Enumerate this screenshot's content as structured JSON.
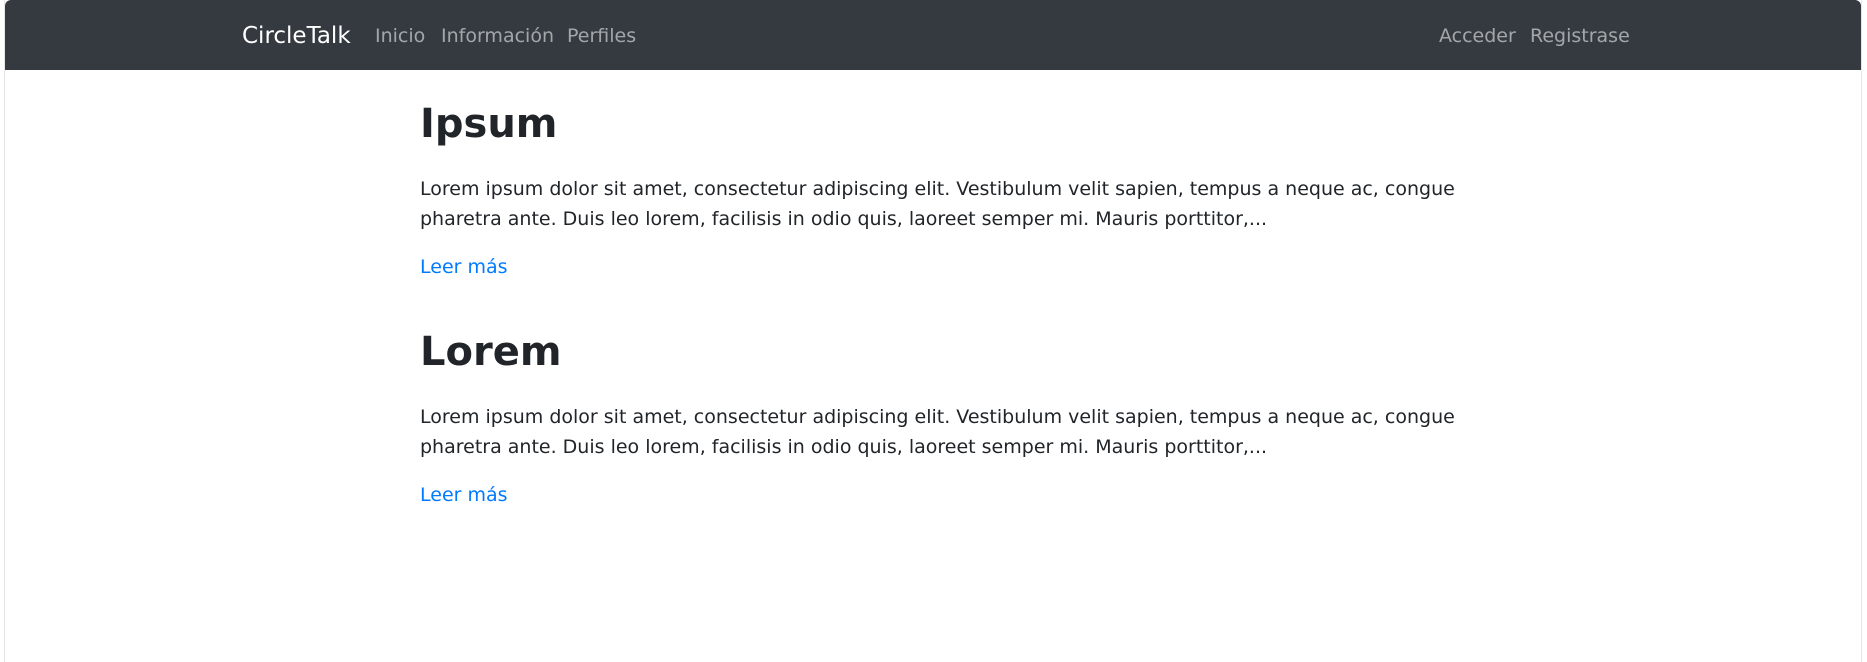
{
  "navbar": {
    "brand": "CircleTalk",
    "left_links": [
      {
        "label": "Inicio"
      },
      {
        "label": "Información"
      },
      {
        "label": "Perfiles"
      }
    ],
    "right_links": [
      {
        "label": "Acceder"
      },
      {
        "label": "Registrase"
      }
    ]
  },
  "posts": [
    {
      "title": "Ipsum",
      "excerpt": "Lorem ipsum dolor sit amet, consectetur adipiscing elit. Vestibulum velit sapien, tempus a neque ac, congue pharetra ante. Duis leo lorem, facilisis in odio quis, laoreet semper mi. Mauris porttitor,...",
      "link_label": "Leer más"
    },
    {
      "title": "Lorem",
      "excerpt": "Lorem ipsum dolor sit amet, consectetur adipiscing elit. Vestibulum velit sapien, tempus a neque ac, congue pharetra ante. Duis leo lorem, facilisis in odio quis, laoreet semper mi. Mauris porttitor,...",
      "link_label": "Leer más"
    }
  ],
  "colors": {
    "navbar_bg": "#343a40",
    "link": "#007bff",
    "text": "#212529"
  }
}
